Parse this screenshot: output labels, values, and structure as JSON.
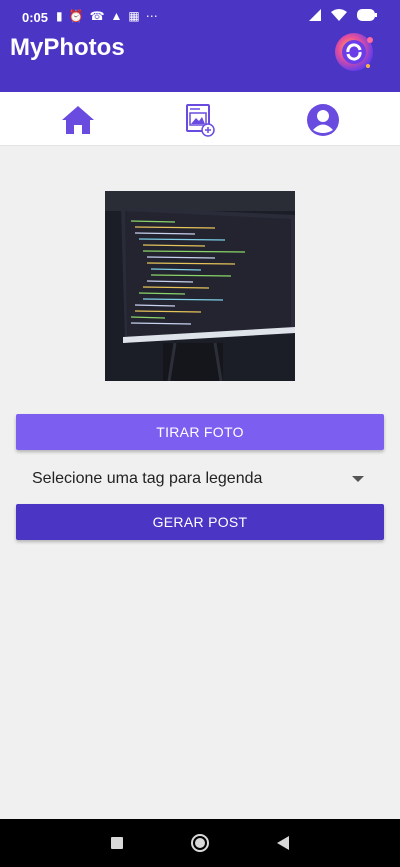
{
  "status_bar": {
    "time": "0:05",
    "left_icons": [
      "vibrate-icon",
      "alarm-icon",
      "whatsapp-icon",
      "android-icon",
      "gallery-icon",
      "more-icon"
    ],
    "right_icons": [
      "signal-icon",
      "wifi-icon",
      "battery-icon"
    ]
  },
  "app_bar": {
    "title": "MyPhotos",
    "logo": "app-logo-icon"
  },
  "tabs": [
    {
      "name": "home",
      "icon": "home-icon"
    },
    {
      "name": "new-post",
      "icon": "image-add-icon"
    },
    {
      "name": "profile",
      "icon": "user-icon"
    }
  ],
  "photo": {
    "description": "monitor-code-photo"
  },
  "buttons": {
    "take_photo": "TIRAR FOTO",
    "generate_post": "GERAR POST"
  },
  "tag_select": {
    "selected": "Selecione uma tag para legenda"
  },
  "colors": {
    "primary": "#4a35c4",
    "accent": "#7c5ff0",
    "icon": "#6a4be0"
  },
  "nav_bar": {
    "buttons": [
      "recents-icon",
      "home-circle-icon",
      "back-icon"
    ]
  }
}
